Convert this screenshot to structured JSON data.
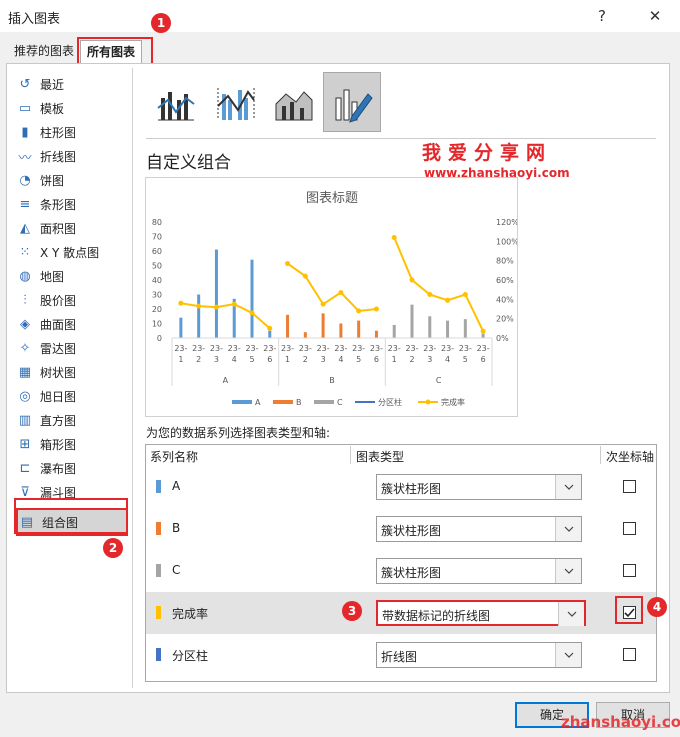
{
  "window": {
    "title": "插入图表",
    "help": "?",
    "close": "✕"
  },
  "tabs": [
    {
      "label": "推荐的图表"
    },
    {
      "label": "所有图表"
    }
  ],
  "sidebar": {
    "items": [
      {
        "label": "最近",
        "icon": "recent-icon"
      },
      {
        "label": "模板",
        "icon": "template-icon"
      },
      {
        "label": "柱形图",
        "icon": "column-chart-icon"
      },
      {
        "label": "折线图",
        "icon": "line-chart-icon"
      },
      {
        "label": "饼图",
        "icon": "pie-chart-icon"
      },
      {
        "label": "条形图",
        "icon": "bar-chart-icon"
      },
      {
        "label": "面积图",
        "icon": "area-chart-icon"
      },
      {
        "label": "X Y 散点图",
        "icon": "scatter-chart-icon"
      },
      {
        "label": "地图",
        "icon": "map-chart-icon"
      },
      {
        "label": "股价图",
        "icon": "stock-chart-icon"
      },
      {
        "label": "曲面图",
        "icon": "surface-chart-icon"
      },
      {
        "label": "雷达图",
        "icon": "radar-chart-icon"
      },
      {
        "label": "树状图",
        "icon": "treemap-chart-icon"
      },
      {
        "label": "旭日图",
        "icon": "sunburst-chart-icon"
      },
      {
        "label": "直方图",
        "icon": "histogram-chart-icon"
      },
      {
        "label": "箱形图",
        "icon": "box-chart-icon"
      },
      {
        "label": "瀑布图",
        "icon": "waterfall-chart-icon"
      },
      {
        "label": "漏斗图",
        "icon": "funnel-chart-icon"
      },
      {
        "label": "组合图",
        "icon": "combo-chart-icon"
      }
    ]
  },
  "main": {
    "subheading": "自定义组合",
    "prompt": "为您的数据系列选择图表类型和轴:",
    "grid_headers": {
      "name": "系列名称",
      "type": "图表类型",
      "axis": "次坐标轴"
    },
    "series_rows": [
      {
        "name": "A",
        "type": "簇状柱形图",
        "secondary": false,
        "color": "#5b9bd5"
      },
      {
        "name": "B",
        "type": "簇状柱形图",
        "secondary": false,
        "color": "#ed7d31"
      },
      {
        "name": "C",
        "type": "簇状柱形图",
        "secondary": false,
        "color": "#a5a5a5"
      },
      {
        "name": "完成率",
        "type": "带数据标记的折线图",
        "secondary": true,
        "color": "#ffc000"
      },
      {
        "name": "分区柱",
        "type": "折线图",
        "secondary": false,
        "color": "#4472c4"
      }
    ]
  },
  "watermark": {
    "line1": "我爱分享网",
    "line2": "www.zhanshaoyi.com",
    "line3": "zhanshaoyi.com"
  },
  "badges": [
    "1",
    "2",
    "3",
    "4"
  ],
  "buttons": {
    "ok": "确定",
    "cancel": "取消"
  },
  "chart_data": {
    "type": "bar",
    "title": "图表标题",
    "categories": [
      "23-1",
      "23-2",
      "23-3",
      "23-4",
      "23-5",
      "23-6",
      "23-1",
      "23-2",
      "23-3",
      "23-4",
      "23-5",
      "23-6",
      "23-1",
      "23-2",
      "23-3",
      "23-4",
      "23-5",
      "23-6"
    ],
    "groups": [
      "A",
      "B",
      "C"
    ],
    "ylim": [
      0,
      80
    ],
    "y_ticks": [
      "0",
      "10",
      "20",
      "30",
      "40",
      "50",
      "60",
      "70",
      "80"
    ],
    "y2lim": [
      0,
      1.2
    ],
    "y2_ticks": [
      "0%",
      "20%",
      "40%",
      "60%",
      "80%",
      "100%",
      "120%"
    ],
    "series": [
      {
        "name": "A",
        "color": "#5b9bd5",
        "values": [
          14,
          30,
          61,
          27,
          54,
          5,
          null,
          null,
          null,
          null,
          null,
          null,
          null,
          null,
          null,
          null,
          null,
          null
        ]
      },
      {
        "name": "B",
        "color": "#ed7d31",
        "values": [
          null,
          null,
          null,
          null,
          null,
          null,
          16,
          4,
          17,
          10,
          12,
          5,
          null,
          null,
          null,
          null,
          null,
          null
        ]
      },
      {
        "name": "C",
        "color": "#a5a5a5",
        "values": [
          null,
          null,
          null,
          null,
          null,
          null,
          null,
          null,
          null,
          null,
          null,
          null,
          9,
          23,
          15,
          12,
          13,
          3
        ]
      },
      {
        "name": "完成率",
        "type": "line",
        "axis": "secondary",
        "color": "#ffc000",
        "values": [
          0.36,
          0.33,
          0.32,
          0.35,
          0.26,
          0.1,
          0.77,
          0.64,
          0.35,
          0.47,
          0.28,
          0.3,
          1.04,
          0.6,
          0.45,
          0.39,
          0.45,
          0.07
        ]
      },
      {
        "name": "分区柱",
        "type": "line",
        "color": "#4472c4",
        "values": []
      }
    ],
    "legend": [
      "A",
      "B",
      "C",
      "分区柱",
      "完成率"
    ],
    "legend_position": "bottom",
    "grid": false
  }
}
